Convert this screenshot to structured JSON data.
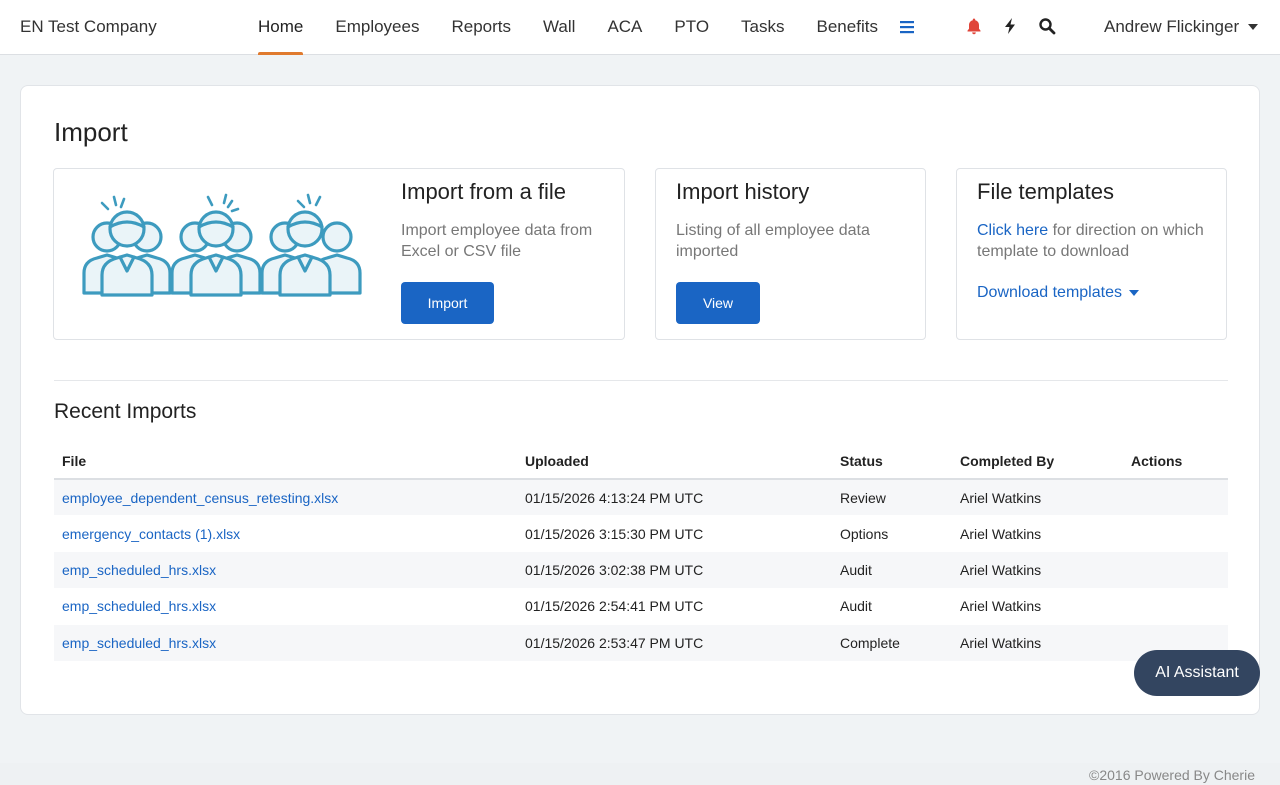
{
  "brand": "EN Test Company",
  "nav": {
    "items": [
      {
        "label": "Home",
        "active": true
      },
      {
        "label": "Employees"
      },
      {
        "label": "Reports"
      },
      {
        "label": "Wall"
      },
      {
        "label": "ACA"
      },
      {
        "label": "PTO"
      },
      {
        "label": "Tasks"
      },
      {
        "label": "Benefits"
      }
    ],
    "menu_icon": "hamburger-icon",
    "icons": [
      "bell-icon",
      "bolt-icon",
      "search-icon"
    ],
    "user": "Andrew Flickinger"
  },
  "page": {
    "title": "Import"
  },
  "panels": {
    "import_file": {
      "title": "Import from a file",
      "description": "Import employee data from Excel or CSV file",
      "button": "Import",
      "illustration": "employees-group-illustration"
    },
    "history": {
      "title": "Import history",
      "description": "Listing of all employee data imported",
      "button": "View"
    },
    "templates": {
      "title": "File templates",
      "link_text": "Click here",
      "description": "for direction on which template to download",
      "dropdown": "Download templates"
    }
  },
  "recent": {
    "title": "Recent Imports",
    "columns": [
      "File",
      "Uploaded",
      "Status",
      "Completed By",
      "Actions"
    ],
    "rows": [
      {
        "file": "employee_dependent_census_retesting.xlsx",
        "uploaded": "01/15/2026 4:13:24 PM UTC",
        "status": "Review",
        "completed_by": "Ariel Watkins",
        "actions": ""
      },
      {
        "file": "emergency_contacts (1).xlsx",
        "uploaded": "01/15/2026 3:15:30 PM UTC",
        "status": "Options",
        "completed_by": "Ariel Watkins",
        "actions": ""
      },
      {
        "file": "emp_scheduled_hrs.xlsx",
        "uploaded": "01/15/2026 3:02:38 PM UTC",
        "status": "Audit",
        "completed_by": "Ariel Watkins",
        "actions": ""
      },
      {
        "file": "emp_scheduled_hrs.xlsx",
        "uploaded": "01/15/2026 2:54:41 PM UTC",
        "status": "Audit",
        "completed_by": "Ariel Watkins",
        "actions": ""
      },
      {
        "file": "emp_scheduled_hrs.xlsx",
        "uploaded": "01/15/2026 2:53:47 PM UTC",
        "status": "Complete",
        "completed_by": "Ariel Watkins",
        "actions": ""
      }
    ]
  },
  "ai_assistant": "AI Assistant",
  "footer": "©2016 Powered By Cherie",
  "colors": {
    "accent": "#1a65c4",
    "active_tab": "#e07a2e",
    "bell": "#e0453a",
    "assistant_bg": "#334560",
    "illustration": "#3d9bbf"
  }
}
